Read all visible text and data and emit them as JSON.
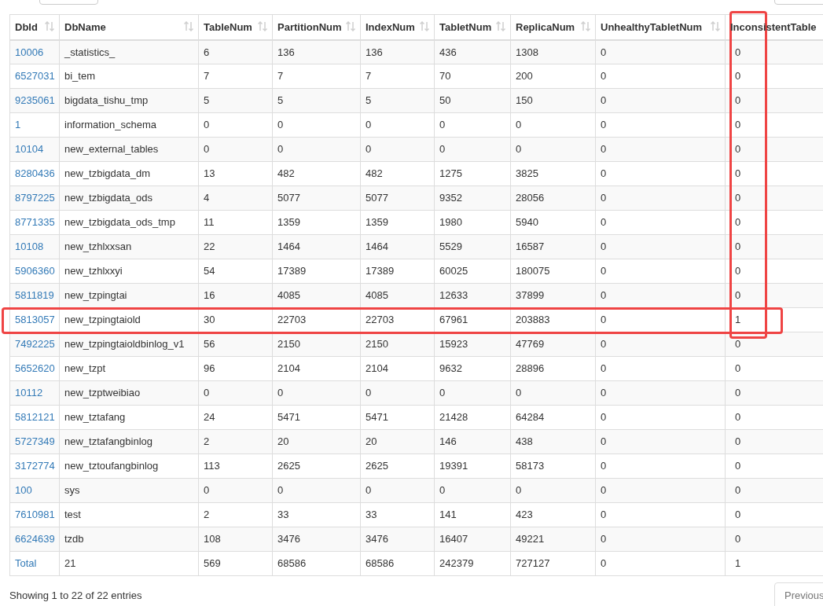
{
  "table": {
    "columns": [
      "DbId",
      "DbName",
      "TableNum",
      "PartitionNum",
      "IndexNum",
      "TabletNum",
      "ReplicaNum",
      "UnhealthyTabletNum",
      "InconsistentTable"
    ],
    "rows": [
      [
        "10006",
        "_statistics_",
        "6",
        "136",
        "136",
        "436",
        "1308",
        "0",
        "0"
      ],
      [
        "6527031",
        "bi_tem",
        "7",
        "7",
        "7",
        "70",
        "200",
        "0",
        "0"
      ],
      [
        "9235061",
        "bigdata_tishu_tmp",
        "5",
        "5",
        "5",
        "50",
        "150",
        "0",
        "0"
      ],
      [
        "1",
        "information_schema",
        "0",
        "0",
        "0",
        "0",
        "0",
        "0",
        "0"
      ],
      [
        "10104",
        "new_external_tables",
        "0",
        "0",
        "0",
        "0",
        "0",
        "0",
        "0"
      ],
      [
        "8280436",
        "new_tzbigdata_dm",
        "13",
        "482",
        "482",
        "1275",
        "3825",
        "0",
        "0"
      ],
      [
        "8797225",
        "new_tzbigdata_ods",
        "4",
        "5077",
        "5077",
        "9352",
        "28056",
        "0",
        "0"
      ],
      [
        "8771335",
        "new_tzbigdata_ods_tmp",
        "11",
        "1359",
        "1359",
        "1980",
        "5940",
        "0",
        "0"
      ],
      [
        "10108",
        "new_tzhlxxsan",
        "22",
        "1464",
        "1464",
        "5529",
        "16587",
        "0",
        "0"
      ],
      [
        "5906360",
        "new_tzhlxxyi",
        "54",
        "17389",
        "17389",
        "60025",
        "180075",
        "0",
        "0"
      ],
      [
        "5811819",
        "new_tzpingtai",
        "16",
        "4085",
        "4085",
        "12633",
        "37899",
        "0",
        "0"
      ],
      [
        "5813057",
        "new_tzpingtaiold",
        "30",
        "22703",
        "22703",
        "67961",
        "203883",
        "0",
        "1"
      ],
      [
        "7492225",
        "new_tzpingtaioldbinlog_v1",
        "56",
        "2150",
        "2150",
        "15923",
        "47769",
        "0",
        "0"
      ],
      [
        "5652620",
        "new_tzpt",
        "96",
        "2104",
        "2104",
        "9632",
        "28896",
        "0",
        "0"
      ],
      [
        "10112",
        "new_tzptweibiao",
        "0",
        "0",
        "0",
        "0",
        "0",
        "0",
        "0"
      ],
      [
        "5812121",
        "new_tztafang",
        "24",
        "5471",
        "5471",
        "21428",
        "64284",
        "0",
        "0"
      ],
      [
        "5727349",
        "new_tztafangbinlog",
        "2",
        "20",
        "20",
        "146",
        "438",
        "0",
        "0"
      ],
      [
        "3172774",
        "new_tztoufangbinlog",
        "113",
        "2625",
        "2625",
        "19391",
        "58173",
        "0",
        "0"
      ],
      [
        "100",
        "sys",
        "0",
        "0",
        "0",
        "0",
        "0",
        "0",
        "0"
      ],
      [
        "7610981",
        "test",
        "2",
        "33",
        "33",
        "141",
        "423",
        "0",
        "0"
      ],
      [
        "6624639",
        "tzdb",
        "108",
        "3476",
        "3476",
        "16407",
        "49221",
        "0",
        "0"
      ],
      [
        "Total",
        "21",
        "569",
        "68586",
        "68586",
        "242379",
        "727127",
        "0",
        "1"
      ]
    ]
  },
  "footer": {
    "info": "Showing 1 to 22 of 22 entries",
    "previous_button": "Previous"
  }
}
